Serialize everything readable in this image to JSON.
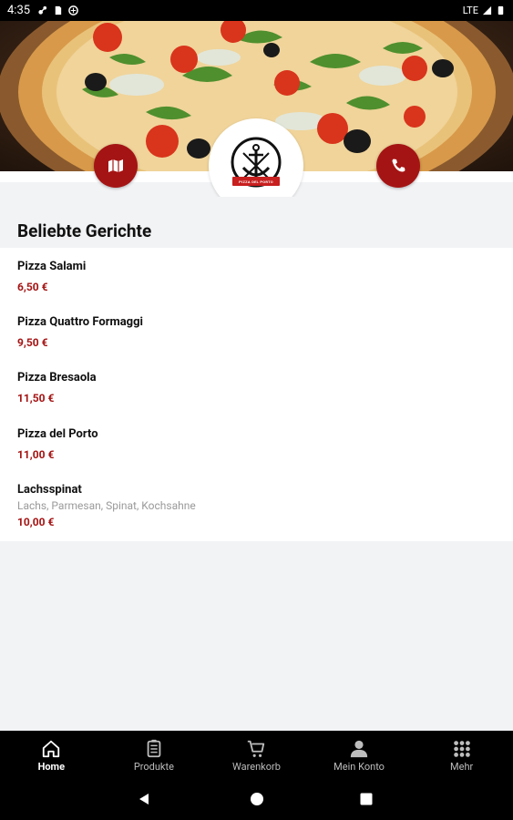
{
  "status_bar": {
    "time": "4:35",
    "network": "LTE"
  },
  "hero": {
    "logo_text": "PIZZA DEL PORTO"
  },
  "section": {
    "title": "Beliebte Gerichte"
  },
  "dishes": [
    {
      "name": "Pizza Salami",
      "description": "",
      "price": "6,50 €"
    },
    {
      "name": "Pizza Quattro Formaggi",
      "description": "",
      "price": "9,50 €"
    },
    {
      "name": "Pizza Bresaola",
      "description": "",
      "price": "11,50 €"
    },
    {
      "name": "Pizza del Porto",
      "description": "",
      "price": "11,00 €"
    },
    {
      "name": "Lachsspinat",
      "description": "Lachs, Parmesan, Spinat, Kochsahne",
      "price": "10,00 €"
    }
  ],
  "bottom_nav": {
    "items": [
      {
        "label": "Home",
        "icon": "home-icon",
        "active": true
      },
      {
        "label": "Produkte",
        "icon": "menu-card-icon",
        "active": false
      },
      {
        "label": "Warenkorb",
        "icon": "cart-icon",
        "active": false
      },
      {
        "label": "Mein Konto",
        "icon": "person-icon",
        "active": false
      },
      {
        "label": "Mehr",
        "icon": "grid-icon",
        "active": false
      }
    ]
  },
  "colors": {
    "accent": "#a51414",
    "background": "#f2f3f5",
    "nav_background": "#000000"
  }
}
